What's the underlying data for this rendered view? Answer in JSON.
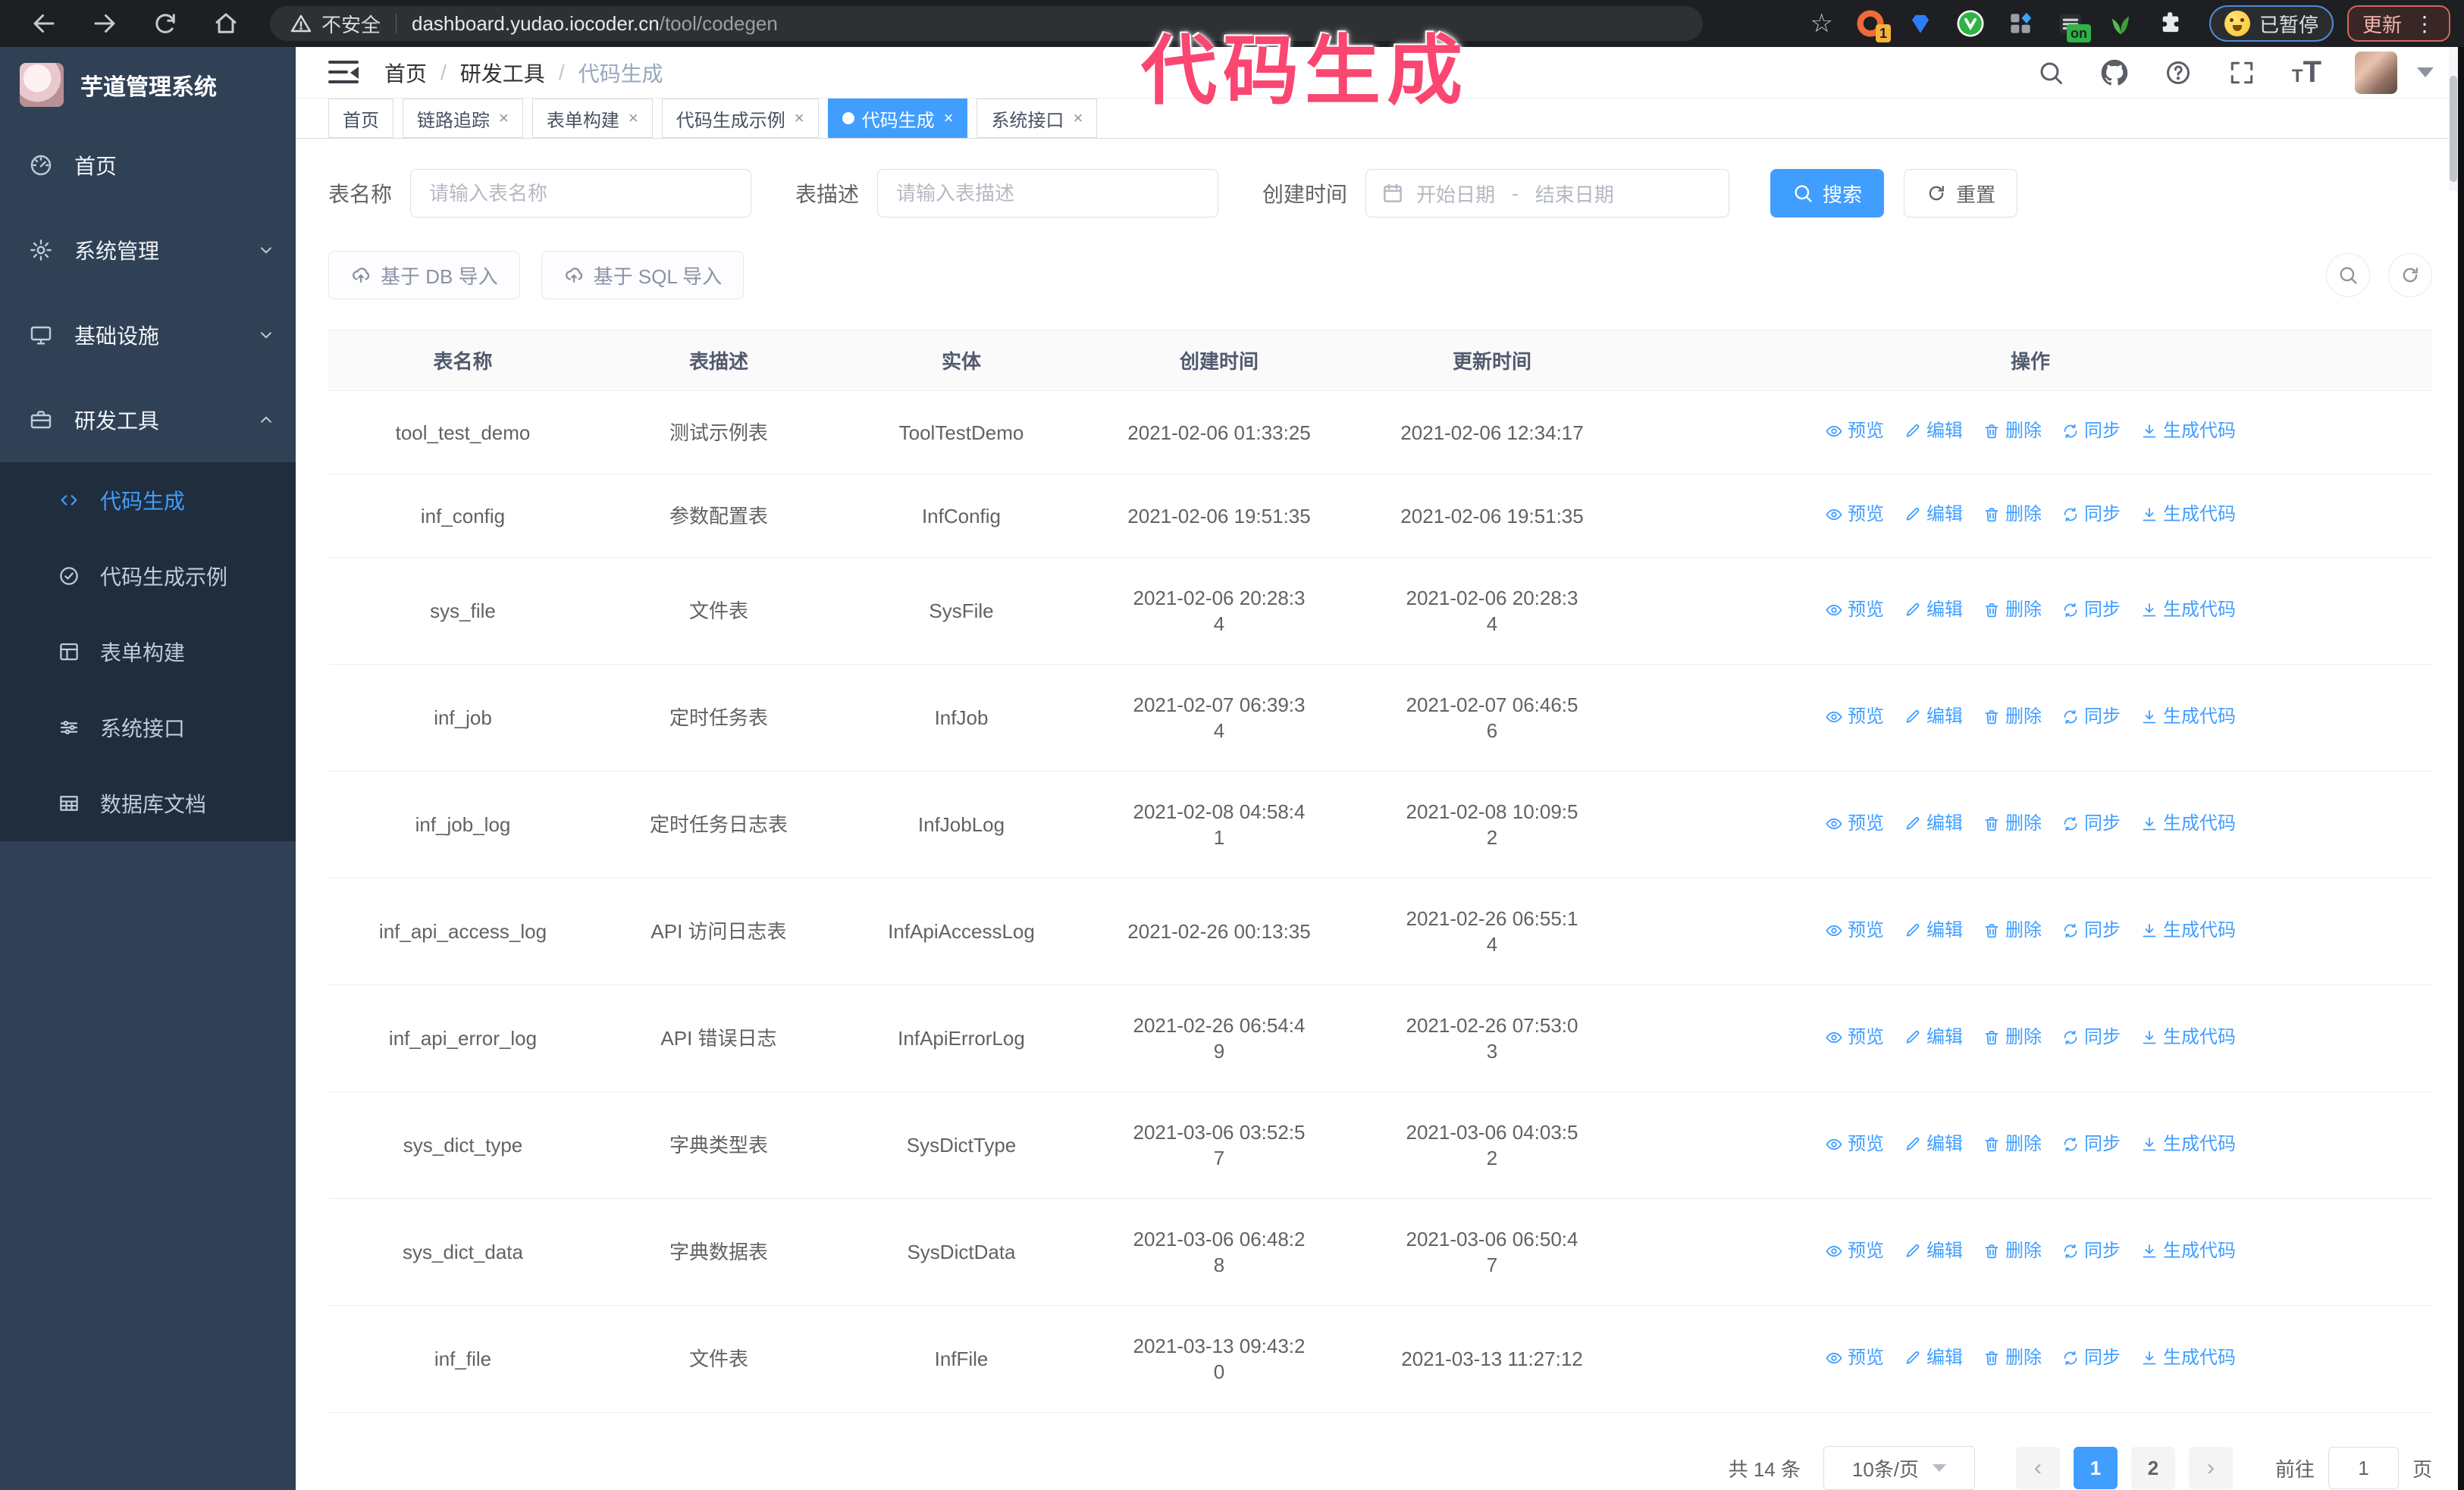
{
  "browser": {
    "security_label": "不安全",
    "url_host": "dashboard.yudao.iocoder.cn",
    "url_path": "/tool/codegen",
    "paused_badge_label": "已暂停",
    "update_button_label": "更新",
    "extensions": [
      {
        "name": "orange-ring-extension-icon",
        "shape": "ring",
        "color": "#f06a35",
        "badge": "1",
        "badge_color": "#f7b239"
      },
      {
        "name": "gem-extension-icon",
        "shape": "gem",
        "color": "#2f7df6"
      },
      {
        "name": "green-v-extension-icon",
        "shape": "circle-v",
        "color": "#2fb344"
      },
      {
        "name": "grid-extension-icon",
        "shape": "grid",
        "color": "#9aa0a6",
        "accent": "#37a6f5"
      },
      {
        "name": "bars-on-extension-icon",
        "shape": "bars",
        "color": "#2b2e31",
        "badge": "on",
        "badge_color": "#2fb344"
      },
      {
        "name": "leaf-extension-icon",
        "shape": "leaf",
        "color": "#3f9d3a"
      },
      {
        "name": "puzzle-extension-icon",
        "shape": "puzzle",
        "color": "#e8eaed"
      }
    ]
  },
  "annotation": {
    "text": "代码生成",
    "color": "#fa4671"
  },
  "sidebar": {
    "title": "芋道管理系统",
    "menu": [
      {
        "label": "首页",
        "icon": "gauge-icon",
        "chevron": ""
      },
      {
        "label": "系统管理",
        "icon": "gear-icon",
        "chevron": "down"
      },
      {
        "label": "基础设施",
        "icon": "monitor-icon",
        "chevron": "down"
      },
      {
        "label": "研发工具",
        "icon": "briefcase-icon",
        "chevron": "up"
      }
    ],
    "submenu": [
      {
        "label": "代码生成",
        "icon": "code-icon",
        "active": true
      },
      {
        "label": "代码生成示例",
        "icon": "badge-check-icon",
        "active": false
      },
      {
        "label": "表单构建",
        "icon": "form-icon",
        "active": false
      },
      {
        "label": "系统接口",
        "icon": "sliders-icon",
        "active": false
      },
      {
        "label": "数据库文档",
        "icon": "db-table-icon",
        "active": false
      }
    ]
  },
  "navbar": {
    "breadcrumb": [
      "首页",
      "研发工具",
      "代码生成"
    ]
  },
  "tags": [
    {
      "label": "首页",
      "closable": false,
      "active": false
    },
    {
      "label": "链路追踪",
      "closable": true,
      "active": false
    },
    {
      "label": "表单构建",
      "closable": true,
      "active": false
    },
    {
      "label": "代码生成示例",
      "closable": true,
      "active": false
    },
    {
      "label": "代码生成",
      "closable": true,
      "active": true
    },
    {
      "label": "系统接口",
      "closable": true,
      "active": false
    }
  ],
  "filters": {
    "table_name_label": "表名称",
    "table_name_placeholder": "请输入表名称",
    "table_desc_label": "表描述",
    "table_desc_placeholder": "请输入表描述",
    "create_time_label": "创建时间",
    "start_placeholder": "开始日期",
    "range_separator": "-",
    "end_placeholder": "结束日期",
    "search_button": "搜索",
    "reset_button": "重置"
  },
  "toolbar": {
    "import_db_button": "基于 DB 导入",
    "import_sql_button": "基于 SQL 导入"
  },
  "table": {
    "columns": [
      "表名称",
      "表描述",
      "实体",
      "创建时间",
      "更新时间",
      "操作"
    ],
    "actions": [
      {
        "label": "预览",
        "icon": "eye-icon"
      },
      {
        "label": "编辑",
        "icon": "edit-icon"
      },
      {
        "label": "删除",
        "icon": "delete-icon"
      },
      {
        "label": "同步",
        "icon": "sync-icon"
      },
      {
        "label": "生成代码",
        "icon": "download-icon"
      }
    ],
    "rows": [
      {
        "name": "tool_test_demo",
        "desc": "测试示例表",
        "entity": "ToolTestDemo",
        "created": "2021-02-06 01:33:25",
        "updated": "2021-02-06 12:34:17"
      },
      {
        "name": "inf_config",
        "desc": "参数配置表",
        "entity": "InfConfig",
        "created": "2021-02-06 19:51:35",
        "updated": "2021-02-06 19:51:35"
      },
      {
        "name": "sys_file",
        "desc": "文件表",
        "entity": "SysFile",
        "created": "2021-02-06 20:28:3\n4",
        "updated": "2021-02-06 20:28:3\n4"
      },
      {
        "name": "inf_job",
        "desc": "定时任务表",
        "entity": "InfJob",
        "created": "2021-02-07 06:39:3\n4",
        "updated": "2021-02-07 06:46:5\n6"
      },
      {
        "name": "inf_job_log",
        "desc": "定时任务日志表",
        "entity": "InfJobLog",
        "created": "2021-02-08 04:58:4\n1",
        "updated": "2021-02-08 10:09:5\n2"
      },
      {
        "name": "inf_api_access_log",
        "desc": "API 访问日志表",
        "entity": "InfApiAccessLog",
        "created": "2021-02-26 00:13:35",
        "updated": "2021-02-26 06:55:1\n4"
      },
      {
        "name": "inf_api_error_log",
        "desc": "API 错误日志",
        "entity": "InfApiErrorLog",
        "created": "2021-02-26 06:54:4\n9",
        "updated": "2021-02-26 07:53:0\n3"
      },
      {
        "name": "sys_dict_type",
        "desc": "字典类型表",
        "entity": "SysDictType",
        "created": "2021-03-06 03:52:5\n7",
        "updated": "2021-03-06 04:03:5\n2"
      },
      {
        "name": "sys_dict_data",
        "desc": "字典数据表",
        "entity": "SysDictData",
        "created": "2021-03-06 06:48:2\n8",
        "updated": "2021-03-06 06:50:4\n7"
      },
      {
        "name": "inf_file",
        "desc": "文件表",
        "entity": "InfFile",
        "created": "2021-03-13 09:43:2\n0",
        "updated": "2021-03-13 11:27:12"
      }
    ]
  },
  "pagination": {
    "total_label": "共 14 条",
    "page_size_label": "10条/页",
    "pages": [
      "1",
      "2"
    ],
    "active_page": "1",
    "goto_label": "前往",
    "goto_value": "1",
    "page_unit_label": "页"
  },
  "colors": {
    "primary": "#409eff",
    "sidebar_bg": "#304156",
    "submenu_bg": "#1f2d3d",
    "annotation_pink": "#fa4671"
  }
}
